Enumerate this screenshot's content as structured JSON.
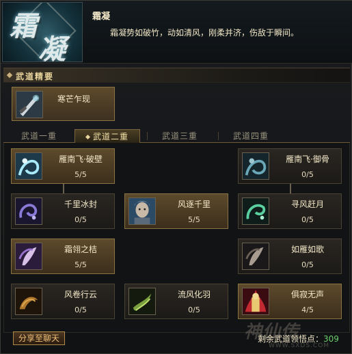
{
  "header": {
    "logo_glyph_1": "霜",
    "logo_glyph_2": "凝",
    "title": "霜凝",
    "description": "霜凝势如破竹，动如清风，刚柔并济，伤敌于瞬间。"
  },
  "section": {
    "title": "武道精要"
  },
  "core_skill": {
    "name": "寒芒乍现",
    "icon": "blade-icon"
  },
  "tabs": [
    {
      "label": "武道一重",
      "active": false
    },
    {
      "label": "武道二重",
      "active": true
    },
    {
      "label": "武道三重",
      "active": false
    },
    {
      "label": "武道四重",
      "active": false
    }
  ],
  "skills": [
    {
      "name": "雁南飞·破壁",
      "rank": "5/5",
      "icon": "swirl-cyan-icon",
      "learned": true
    },
    {
      "name": "雁南飞·御骨",
      "rank": "0/5",
      "icon": "swirl-cyan-icon",
      "learned": false
    },
    {
      "name": "千里冰封",
      "rank": "0/5",
      "icon": "purple-swirl-icon",
      "learned": false
    },
    {
      "name": "风逐千里",
      "rank": "5/5",
      "icon": "portrait-icon",
      "learned": true
    },
    {
      "name": "寻风赶月",
      "rank": "0/5",
      "icon": "green-swirl-icon",
      "learned": false
    },
    {
      "name": "霜翎之桔",
      "rank": "5/5",
      "icon": "purple-feather-icon",
      "learned": true
    },
    {
      "name": "如雁如歌",
      "rank": "0/5",
      "icon": "feather-icon",
      "learned": false
    },
    {
      "name": "风卷行云",
      "rank": "0/5",
      "icon": "golden-wind-icon",
      "learned": false
    },
    {
      "name": "流风化羽",
      "rank": "0/5",
      "icon": "green-wind-icon",
      "learned": false
    },
    {
      "name": "俱寂无声",
      "rank": "4/5",
      "icon": "fire-mage-icon",
      "learned": true
    }
  ],
  "footer": {
    "share_label": "分享至聊天",
    "remaining_label": "剩余武道领悟点：",
    "remaining_value": "309",
    "watermark": "神仙传",
    "watermark_url": "WWW.SXDS.COM"
  },
  "colors": {
    "gold_border": "#8a7444",
    "text": "#f3e8c8",
    "points_green": "#6ad06a"
  }
}
